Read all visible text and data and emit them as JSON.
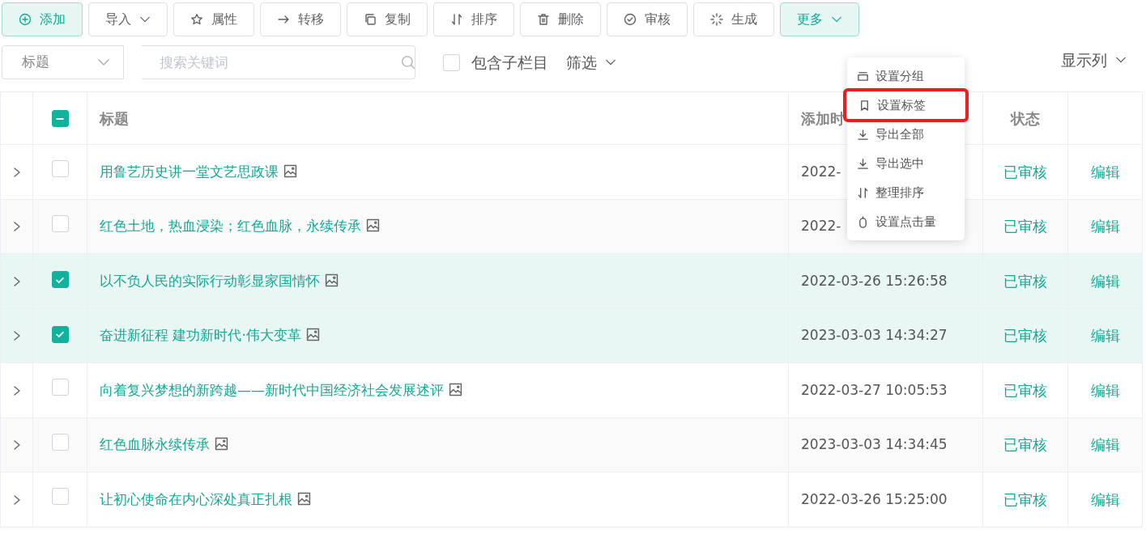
{
  "toolbar": [
    {
      "label": "添加",
      "primary": true,
      "caret": false
    },
    {
      "label": "导入",
      "primary": false,
      "caret": true
    },
    {
      "label": "属性",
      "primary": false,
      "caret": false
    },
    {
      "label": "转移",
      "primary": false,
      "caret": false
    },
    {
      "label": "复制",
      "primary": false,
      "caret": false
    },
    {
      "label": "排序",
      "primary": false,
      "caret": false
    },
    {
      "label": "删除",
      "primary": false,
      "caret": false
    },
    {
      "label": "审核",
      "primary": false,
      "caret": false
    },
    {
      "label": "生成",
      "primary": false,
      "caret": false
    },
    {
      "label": "更多",
      "primary": true,
      "caret": true
    }
  ],
  "search": {
    "field": "标题",
    "placeholder": "搜索关键词"
  },
  "include_subcolumns": {
    "label": "包含子栏目",
    "checked": false
  },
  "filter": "筛选",
  "show_columns": "显示列",
  "table": {
    "header_partial": true,
    "columns": [
      "标题",
      "添加时",
      "状态"
    ],
    "rows": [
      {
        "title": "用鲁艺历史讲一堂文艺思政课",
        "date": "2022-",
        "status": "已审核",
        "action": "编辑",
        "selected": false
      },
      {
        "title": "红色土地，热血浸染；红色血脉，永续传承",
        "date": "2022-",
        "status": "已审核",
        "action": "编辑",
        "selected": false
      },
      {
        "title": "以不负人民的实际行动彰显家国情怀",
        "date": "2022-03-26 15:26:58",
        "status": "已审核",
        "action": "编辑",
        "selected": true
      },
      {
        "title": "奋进新征程 建功新时代·伟大变革",
        "date": "2023-03-03 14:34:27",
        "status": "已审核",
        "action": "编辑",
        "selected": true
      },
      {
        "title": "向着复兴梦想的新跨越——新时代中国经济社会发展述评",
        "date": "2022-03-27 10:05:53",
        "status": "已审核",
        "action": "编辑",
        "selected": false
      },
      {
        "title": "红色血脉永续传承",
        "date": "2023-03-03 14:34:45",
        "status": "已审核",
        "action": "编辑",
        "selected": false
      },
      {
        "title": "让初心使命在内心深处真正扎根",
        "date": "2022-03-26 15:25:00",
        "status": "已审核",
        "action": "编辑",
        "selected": false
      }
    ]
  },
  "dropdown": {
    "items": [
      {
        "label": "设置分组",
        "highlighted": false
      },
      {
        "label": "设置标签",
        "highlighted": true
      },
      {
        "label": "导出全部",
        "highlighted": false
      },
      {
        "label": "导出选中",
        "highlighted": false
      },
      {
        "label": "整理排序",
        "highlighted": false
      },
      {
        "label": "设置点击量",
        "highlighted": false
      }
    ]
  }
}
